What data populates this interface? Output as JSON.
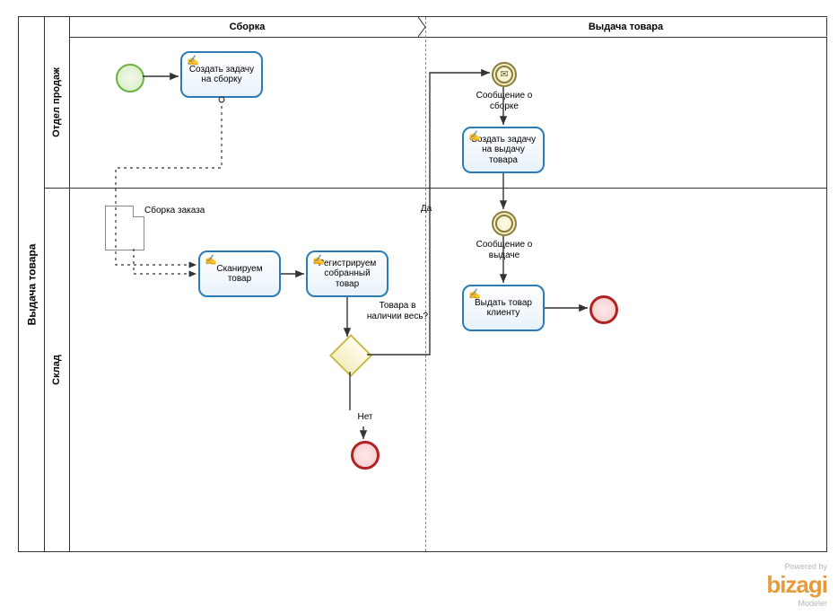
{
  "pool": {
    "title": "Выдача товара"
  },
  "lanes": {
    "sales": "Отдел продаж",
    "warehouse": "Склад"
  },
  "phases": {
    "assembly": "Сборка",
    "issue": "Выдача товара"
  },
  "tasks": {
    "create_assembly": "Создать задачу на сборку",
    "scan": "Сканируем товар",
    "register": "Регистрируем собранный товар",
    "create_issue": "Создать задачу на выдачу товара",
    "issue_client": "Выдать товар клиенту"
  },
  "events": {
    "msg_assembled": "Сообщение о сборке",
    "msg_issue": "Сообщение о выдаче"
  },
  "data_objects": {
    "order": "Сборка заказа"
  },
  "gateways": {
    "all_in_stock": "Товара в наличии весь?",
    "yes": "Да",
    "no": "Нет"
  },
  "branding": {
    "powered": "Powered by",
    "name": "bizagi",
    "sub": "Modeler"
  }
}
